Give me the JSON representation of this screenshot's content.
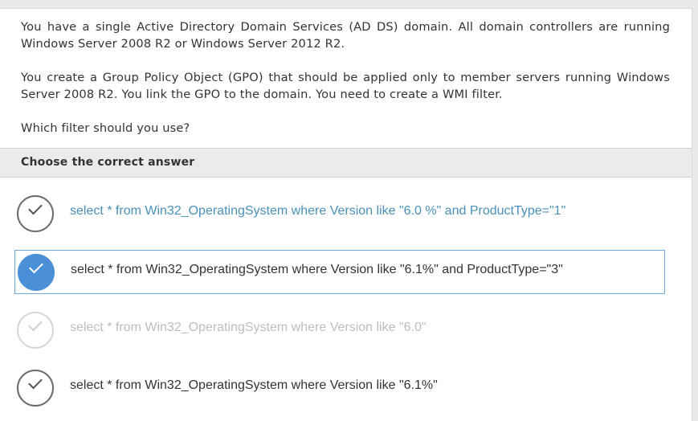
{
  "question": {
    "paragraphs": [
      "You have a single Active Directory Domain Services (AD DS) domain. All domain controllers are running Windows Server 2008 R2 or Windows Server 2012 R2.",
      "You create a Group Policy Object (GPO) that should be applied only to member servers running Windows Server 2008 R2. You link the GPO to the domain. You need to create a WMI filter.",
      "Which filter should you use?"
    ]
  },
  "section": {
    "title": "Choose the correct answer"
  },
  "answers": [
    {
      "text": "select * from Win32_OperatingSystem where Version like \"6.0 %\" and ProductType=\"1\"",
      "state": "hover"
    },
    {
      "text": "select * from Win32_OperatingSystem where Version like \"6.1%\" and ProductType=\"3\"",
      "state": "selected"
    },
    {
      "text": "select * from Win32_OperatingSystem where Version like \"6.0\"",
      "state": "faded"
    },
    {
      "text": "select * from Win32_OperatingSystem where Version like \"6.1%\"",
      "state": "normal"
    }
  ],
  "colors": {
    "accent": "#4a90d9",
    "hover_text": "#4a90b8",
    "section_bg": "#ebebeb"
  },
  "icons": {
    "answer_marker": "check-circle-icon"
  }
}
